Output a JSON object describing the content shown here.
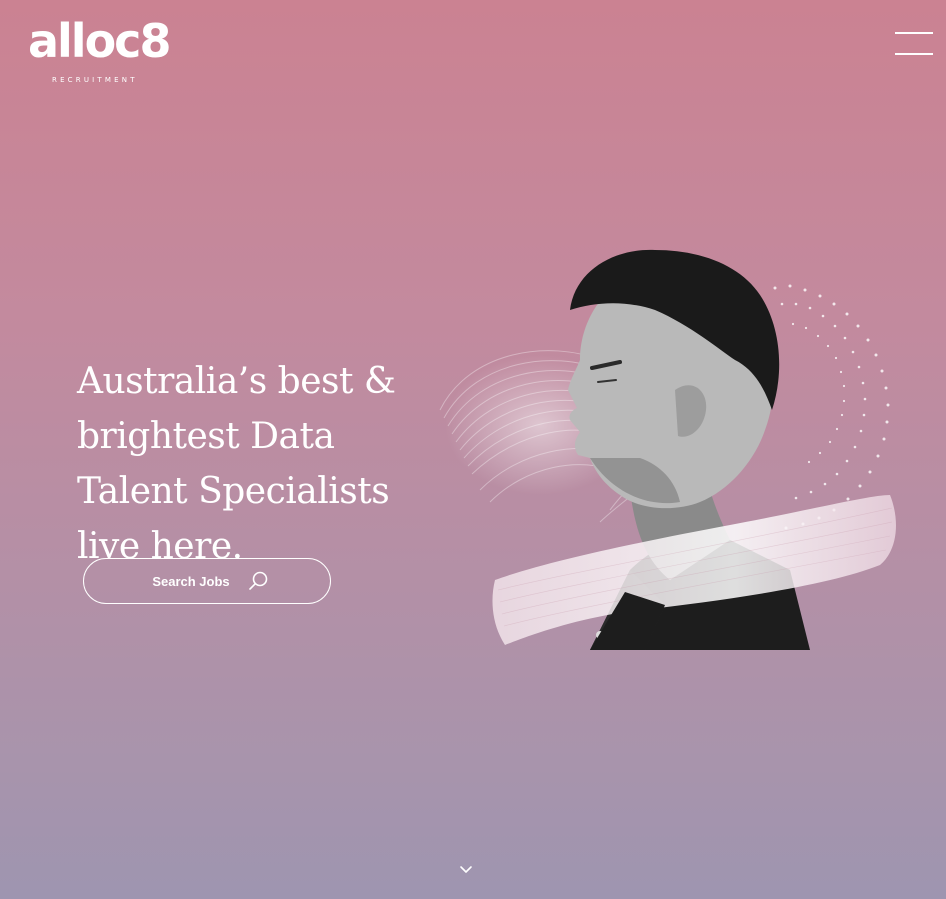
{
  "brand": {
    "logo_text": "alloc8",
    "tagline": "RECRUITMENT"
  },
  "hero": {
    "title": "Australia’s best & brightest Data Talent Specialists live here."
  },
  "search_button": {
    "label": "Search Jobs",
    "icon": "search-icon"
  },
  "nav": {
    "menu_icon": "hamburger-menu-icon"
  },
  "scroll": {
    "icon": "chevron-down-icon"
  },
  "colors": {
    "bg_top": "#cb8292",
    "bg_bottom": "#9e95b0",
    "text": "#ffffff"
  }
}
